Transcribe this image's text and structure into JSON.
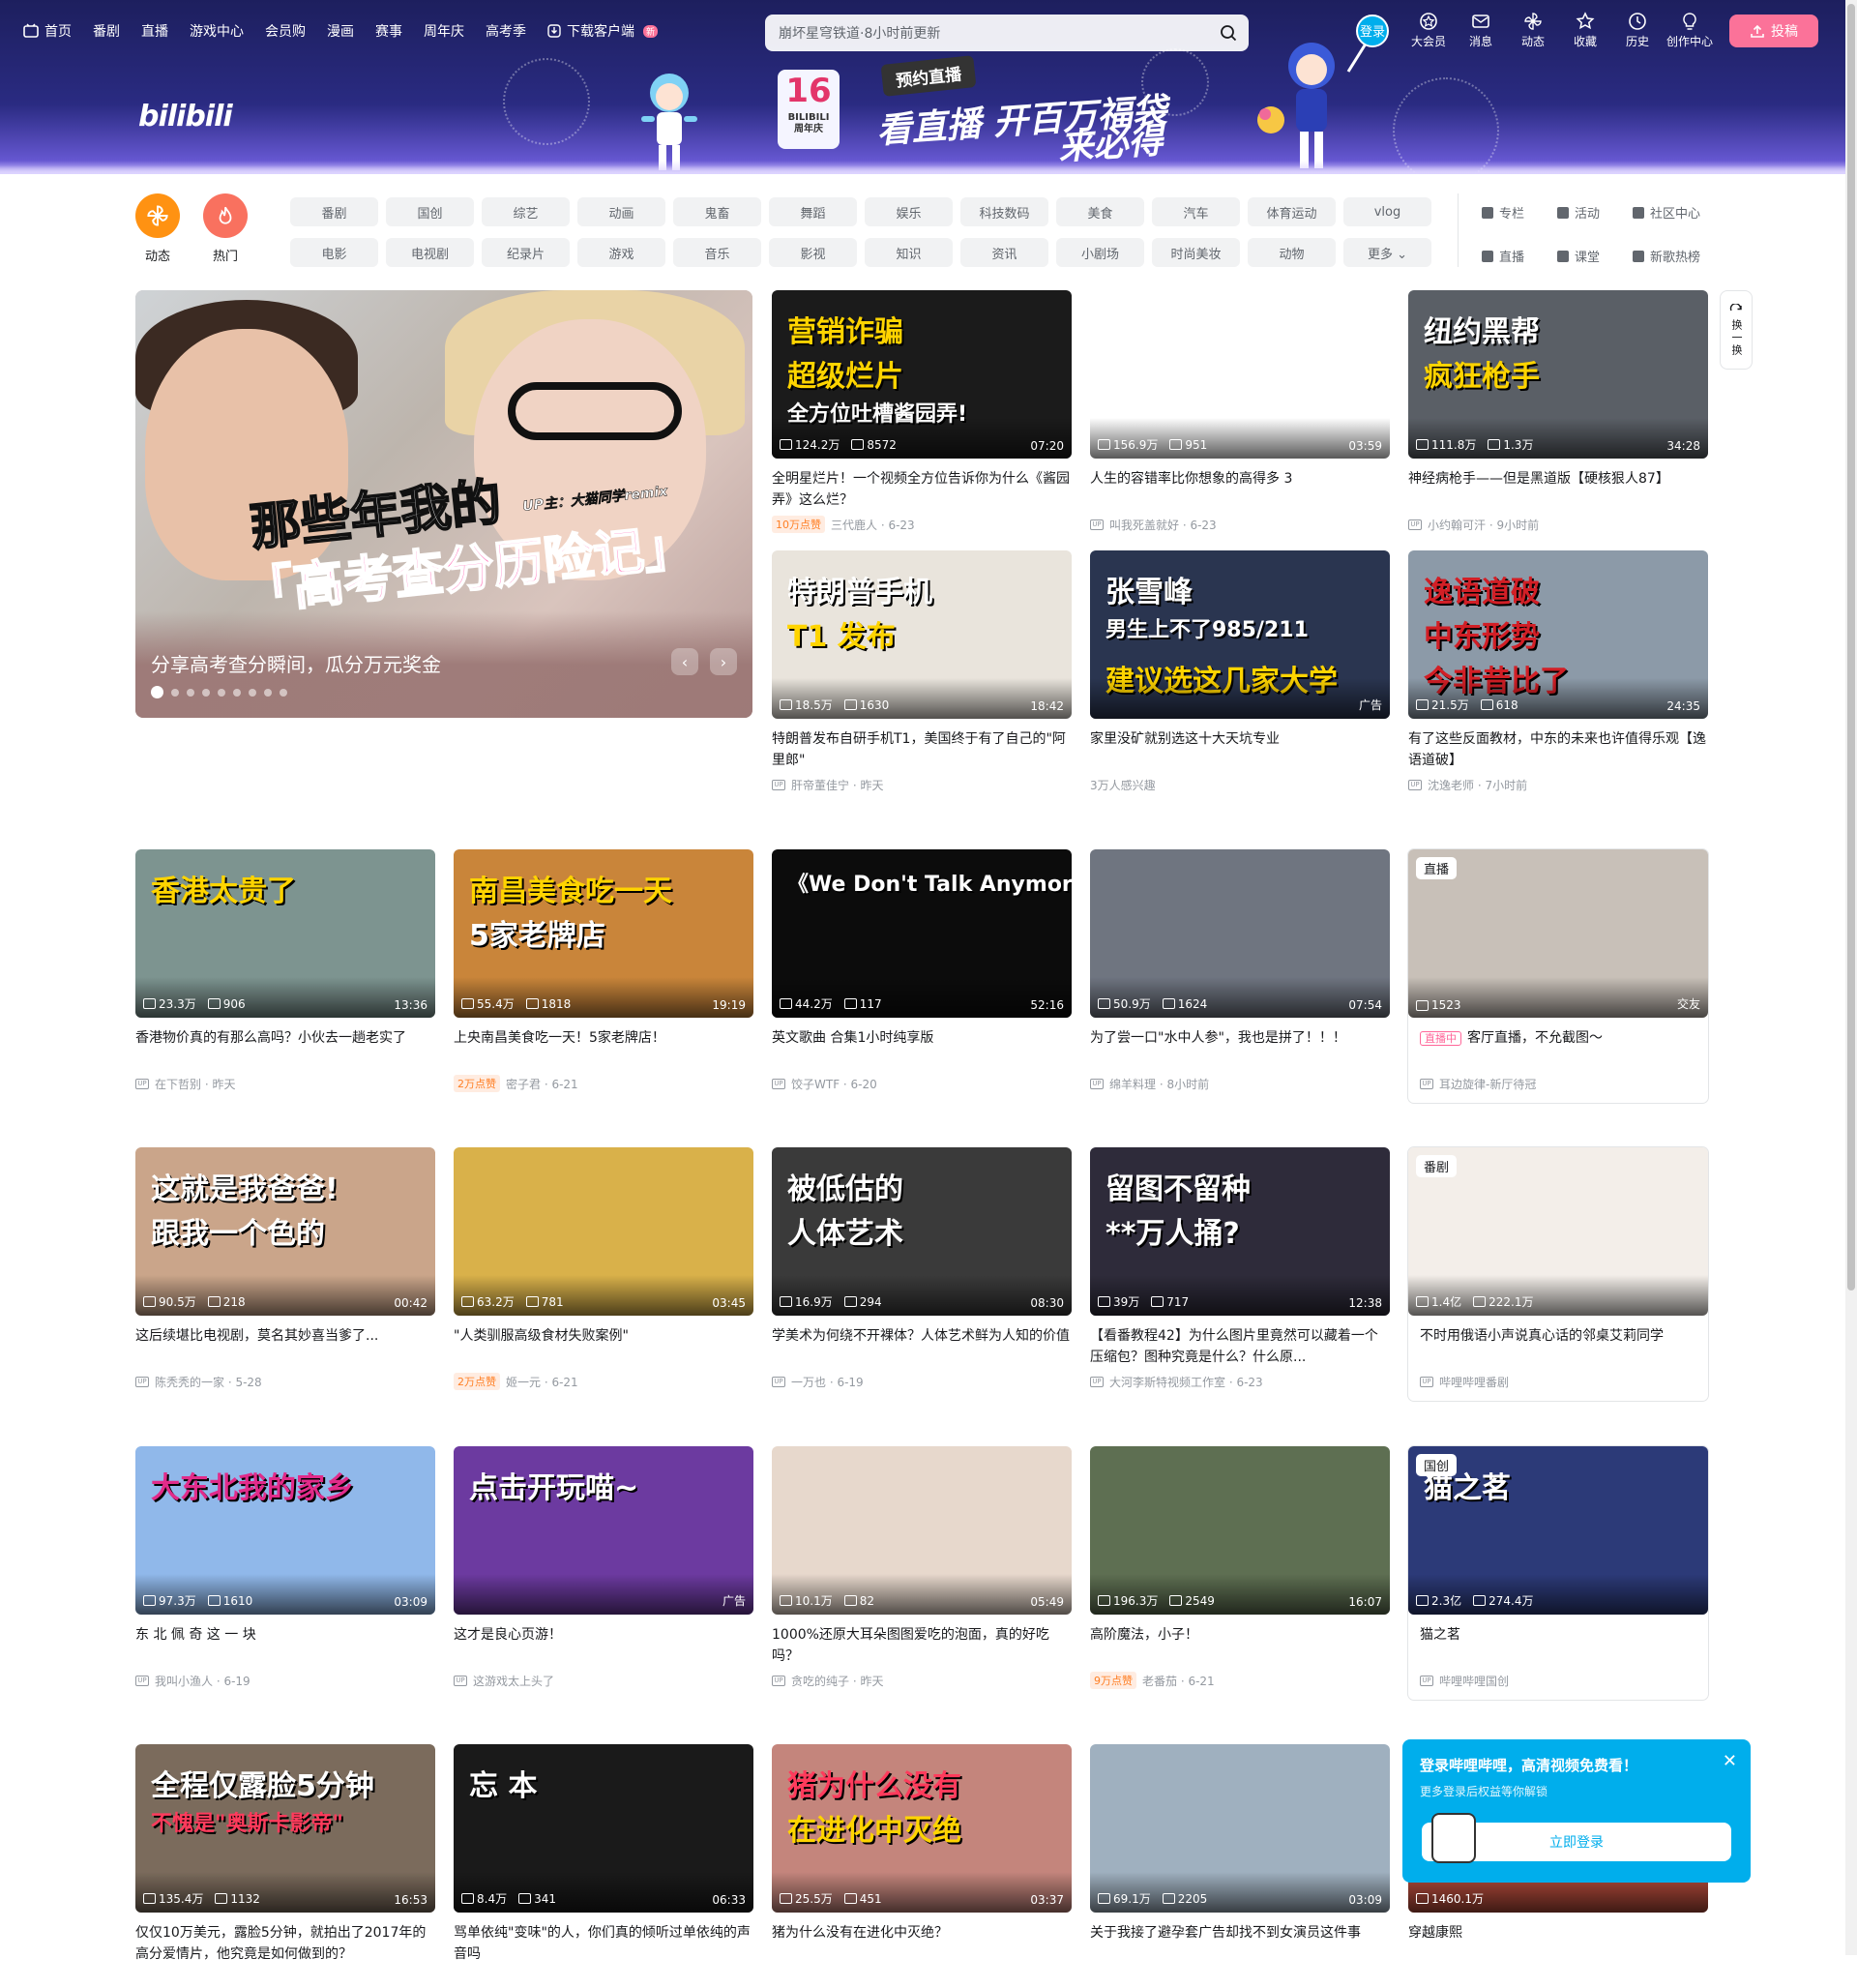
{
  "nav": {
    "items": [
      "首页",
      "番剧",
      "直播",
      "游戏中心",
      "会员购",
      "漫画",
      "赛事",
      "周年庆",
      "高考季",
      "下载客户端"
    ],
    "download_badge": "新",
    "search_placeholder": "崩坏星穹铁道·8小时前更新",
    "login": "登录",
    "right_items": [
      "大会员",
      "消息",
      "动态",
      "收藏",
      "历史",
      "创作中心"
    ],
    "upload": "投稿"
  },
  "banner": {
    "logo": "bilibili",
    "num": "16",
    "sub1": "BILIBILI",
    "sub2": "周年庆",
    "pill": "预约直播",
    "title1": "看直播 开百万福袋",
    "title2": "来必得"
  },
  "channels": {
    "circles": [
      {
        "label": "动态",
        "color": "#ff9212"
      },
      {
        "label": "热门",
        "color": "#f9715f"
      }
    ],
    "tags": [
      "番剧",
      "国创",
      "综艺",
      "动画",
      "鬼畜",
      "舞蹈",
      "娱乐",
      "科技数码",
      "美食",
      "汽车",
      "体育运动",
      "vlog",
      "电影",
      "电视剧",
      "纪录片",
      "游戏",
      "音乐",
      "影视",
      "知识",
      "资讯",
      "小剧场",
      "时尚美妆",
      "动物",
      "更多"
    ],
    "side": [
      "专栏",
      "活动",
      "社区中心",
      "直播",
      "课堂",
      "新歌热榜"
    ]
  },
  "carousel": {
    "caption": "分享高考查分瞬间，瓜分万元奖金",
    "line1": "那些年我的",
    "line2": "「高考查分历险记」",
    "up": "UP主：大猫同学remix",
    "dots": 9
  },
  "refresh": {
    "label": "换一换"
  },
  "cards": [
    {
      "title": "全明星烂片！一个视频全方位告诉你为什么《酱园弄》这么烂？",
      "views": "124.2万",
      "danmaku": "8572",
      "duration": "07:20",
      "up": "三代鹿人",
      "date": "6-23",
      "likes": "10万点赞",
      "thumb": {
        "bg": "#1b1b1b",
        "texts": [
          {
            "t": "营销诈骗",
            "c": "#ffd400"
          },
          {
            "t": "超级烂片",
            "c": "#ffd400"
          },
          {
            "t": "全方位吐槽酱园弄!",
            "c": "#fff"
          }
        ]
      }
    },
    {
      "title": "人生的容错率比你想象的高得多 3",
      "views": "156.9万",
      "danmaku": "951",
      "duration": "03:59",
      "up": "叫我死盖就好",
      "date": "6-23",
      "thumb": {
        "bg": "#ffffff",
        "texts": []
      }
    },
    {
      "title": "神经病枪手——但是黑道版【硬核狠人87】",
      "views": "111.8万",
      "danmaku": "1.3万",
      "duration": "34:28",
      "up": "小约翰可汗",
      "date": "9小时前",
      "thumb": {
        "bg": "#5a5f66",
        "texts": [
          {
            "t": "纽约黑帮",
            "c": "#fff"
          },
          {
            "t": "疯狂枪手",
            "c": "#ffd400"
          }
        ]
      }
    },
    {
      "title": "特朗普发布自研手机T1，美国终于有了自己的\"阿里郎\"",
      "views": "18.5万",
      "danmaku": "1630",
      "duration": "18:42",
      "up": "肝帝董佳宁",
      "date": "昨天",
      "thumb": {
        "bg": "#e9e4dc",
        "texts": [
          {
            "t": "特朗普手机",
            "c": "#fff"
          },
          {
            "t": "T1 发布",
            "c": "#ffd400"
          }
        ]
      }
    },
    {
      "title": "家里没矿就别选这十大天坑专业",
      "views": "",
      "danmaku": "",
      "duration": "广告",
      "up": "",
      "date": "",
      "interest": "3万人感兴趣",
      "thumb": {
        "bg": "#2a3550",
        "texts": [
          {
            "t": "张雪峰",
            "c": "#fff"
          },
          {
            "t": "男生上不了985/211",
            "c": "#fff"
          },
          {
            "t": "建议选这几家大学",
            "c": "#ffd400"
          }
        ]
      }
    },
    {
      "title": "有了这些反面教材，中东的未来也许值得乐观【逸语道破】",
      "views": "21.5万",
      "danmaku": "618",
      "duration": "24:35",
      "up": "沈逸老师",
      "date": "7小时前",
      "thumb": {
        "bg": "#8c9aa8",
        "texts": [
          {
            "t": "逸语道破",
            "c": "#d21f26"
          },
          {
            "t": "中东形势",
            "c": "#d21f26"
          },
          {
            "t": "今非昔比了",
            "c": "#d21f26"
          }
        ]
      }
    },
    {
      "title": "香港物价真的有那么高吗？小伙去一趟老实了",
      "views": "23.3万",
      "danmaku": "906",
      "duration": "13:36",
      "up": "在下哲别",
      "date": "昨天",
      "thumb": {
        "bg": "#7d9490",
        "texts": [
          {
            "t": "香港太贵了",
            "c": "#ffd400"
          }
        ]
      }
    },
    {
      "title": "上央南昌美食吃一天！5家老牌店！",
      "views": "55.4万",
      "danmaku": "1818",
      "duration": "19:19",
      "up": "密子君",
      "date": "6-21",
      "likes": "2万点赞",
      "thumb": {
        "bg": "#c9853a",
        "texts": [
          {
            "t": "南昌美食吃一天",
            "c": "#ffd400"
          },
          {
            "t": "5家老牌店",
            "c": "#fff"
          }
        ]
      }
    },
    {
      "title": "英文歌曲 合集1小时纯享版",
      "views": "44.2万",
      "danmaku": "117",
      "duration": "52:16",
      "up": "饺子WTF",
      "date": "6-20",
      "thumb": {
        "bg": "#0c0c0c",
        "texts": [
          {
            "t": "《We Don't Talk Anymore》",
            "c": "#fff"
          }
        ]
      }
    },
    {
      "title": "为了尝一口\"水中人参\"，我也是拼了！！！",
      "views": "50.9万",
      "danmaku": "1624",
      "duration": "07:54",
      "up": "绵羊料理",
      "date": "8小时前",
      "thumb": {
        "bg": "#6f7580",
        "texts": []
      }
    },
    {
      "title": "客厅直播，不允截图～",
      "views": "1523",
      "danmaku": "",
      "duration": "交友",
      "up": "耳边旋律-新厅待冠",
      "date": "",
      "corner": "直播",
      "live": "直播中",
      "thumb": {
        "bg": "#c8c0b8",
        "texts": []
      }
    },
    {
      "title": "这后续堪比电视剧，莫名其妙喜当爹了...",
      "views": "90.5万",
      "danmaku": "218",
      "duration": "00:42",
      "up": "陈秃秃的一家",
      "date": "5-28",
      "thumb": {
        "bg": "#caa58a",
        "texts": [
          {
            "t": "这就是我爸爸!",
            "c": "#fff"
          },
          {
            "t": "跟我一个色的",
            "c": "#fff"
          }
        ]
      }
    },
    {
      "title": "\"人类驯服高级食材失败案例\"",
      "views": "63.2万",
      "danmaku": "781",
      "duration": "03:45",
      "up": "姬一元",
      "date": "6-21",
      "likes": "2万点赞",
      "thumb": {
        "bg": "#d9b14a",
        "texts": []
      }
    },
    {
      "title": "学美术为何绕不开裸体？人体艺术鲜为人知的价值",
      "views": "16.9万",
      "danmaku": "294",
      "duration": "08:30",
      "up": "一万也",
      "date": "6-19",
      "thumb": {
        "bg": "#3a3a3a",
        "texts": [
          {
            "t": "被低估的",
            "c": "#fff"
          },
          {
            "t": "人体艺术",
            "c": "#fff"
          }
        ]
      }
    },
    {
      "title": "【看番教程42】为什么图片里竟然可以藏着一个压缩包？图种究竟是什么？什么原...",
      "views": "39万",
      "danmaku": "717",
      "duration": "12:38",
      "up": "大河李斯特视频工作室",
      "date": "6-23",
      "thumb": {
        "bg": "#2e2b3a",
        "texts": [
          {
            "t": "留图不留种",
            "c": "#fff"
          },
          {
            "t": "**万人捅?",
            "c": "#fff"
          }
        ]
      }
    },
    {
      "title": "不时用俄语小声说真心话的邻桌艾莉同学",
      "views": "1.4亿",
      "danmaku": "222.1万",
      "duration": "",
      "up": "哔哩哔哩番剧",
      "date": "",
      "corner": "番剧",
      "thumb": {
        "bg": "#f3eee9",
        "texts": []
      }
    },
    {
      "title": "东 北 佩 奇 这 一 块",
      "views": "97.3万",
      "danmaku": "1610",
      "duration": "03:09",
      "up": "我叫小渔人",
      "date": "6-19",
      "thumb": {
        "bg": "#90b8ea",
        "texts": [
          {
            "t": "大东北我的家乡",
            "c": "#e12b8a"
          }
        ]
      }
    },
    {
      "title": "这才是良心页游！",
      "views": "",
      "danmaku": "",
      "duration": "广告",
      "up": "这游戏太上头了",
      "date": "",
      "thumb": {
        "bg": "#6c3aa0",
        "texts": [
          {
            "t": "点击开玩喵~",
            "c": "#fff"
          }
        ]
      }
    },
    {
      "title": "1000%还原大耳朵图图爱吃的泡面，真的好吃吗？",
      "views": "10.1万",
      "danmaku": "82",
      "duration": "05:49",
      "up": "贪吃的纯子",
      "date": "昨天",
      "thumb": {
        "bg": "#e7d8cc",
        "texts": []
      }
    },
    {
      "title": "高阶魔法，小子！",
      "views": "196.3万",
      "danmaku": "2549",
      "duration": "16:07",
      "up": "老番茄",
      "date": "6-21",
      "likes": "9万点赞",
      "thumb": {
        "bg": "#5e6f52",
        "texts": []
      }
    },
    {
      "title": "猫之茗",
      "views": "2.3亿",
      "danmaku": "274.4万",
      "duration": "",
      "up": "哔哩哔哩国创",
      "date": "",
      "corner": "国创",
      "thumb": {
        "bg": "#2c3a78",
        "texts": [
          {
            "t": "猫之茗",
            "c": "#fff"
          }
        ]
      }
    },
    {
      "title": "仅仅10万美元，露脸5分钟，就拍出了2017年的高分爱情片，他究竟是如何做到的？",
      "views": "135.4万",
      "danmaku": "1132",
      "duration": "16:53",
      "up": "",
      "date": "",
      "thumb": {
        "bg": "#7b6b5c",
        "texts": [
          {
            "t": "全程仅露脸5分钟",
            "c": "#fff"
          },
          {
            "t": "不愧是\"奥斯卡影帝\"",
            "c": "#ff3b5c"
          }
        ]
      }
    },
    {
      "title": "骂单依纯\"变味\"的人，你们真的倾听过单依纯的声音吗",
      "views": "8.4万",
      "danmaku": "341",
      "duration": "06:33",
      "up": "",
      "date": "",
      "thumb": {
        "bg": "#1a1a1a",
        "texts": [
          {
            "t": "忘  本",
            "c": "#fff"
          }
        ]
      }
    },
    {
      "title": "猪为什么没有在进化中灭绝？",
      "views": "25.5万",
      "danmaku": "451",
      "duration": "03:37",
      "up": "",
      "date": "",
      "thumb": {
        "bg": "#c4857c",
        "texts": [
          {
            "t": "猪为什么没有",
            "c": "#ff3b5c"
          },
          {
            "t": "在进化中灭绝",
            "c": "#ffd400"
          }
        ]
      }
    },
    {
      "title": "关于我接了避孕套广告却找不到女演员这件事",
      "views": "69.1万",
      "danmaku": "2205",
      "duration": "03:09",
      "up": "",
      "date": "",
      "thumb": {
        "bg": "#9fb0bf",
        "texts": []
      }
    },
    {
      "title": "穿越康熙",
      "views": "1460.1万",
      "danmaku": "",
      "duration": "",
      "up": "",
      "date": "",
      "thumb": {
        "bg": "#b24a3a",
        "texts": []
      }
    }
  ],
  "popup": {
    "title": "登录哔哩哔哩，高清视频免费看！",
    "sub": "更多登录后权益等你解锁",
    "button": "立即登录"
  }
}
